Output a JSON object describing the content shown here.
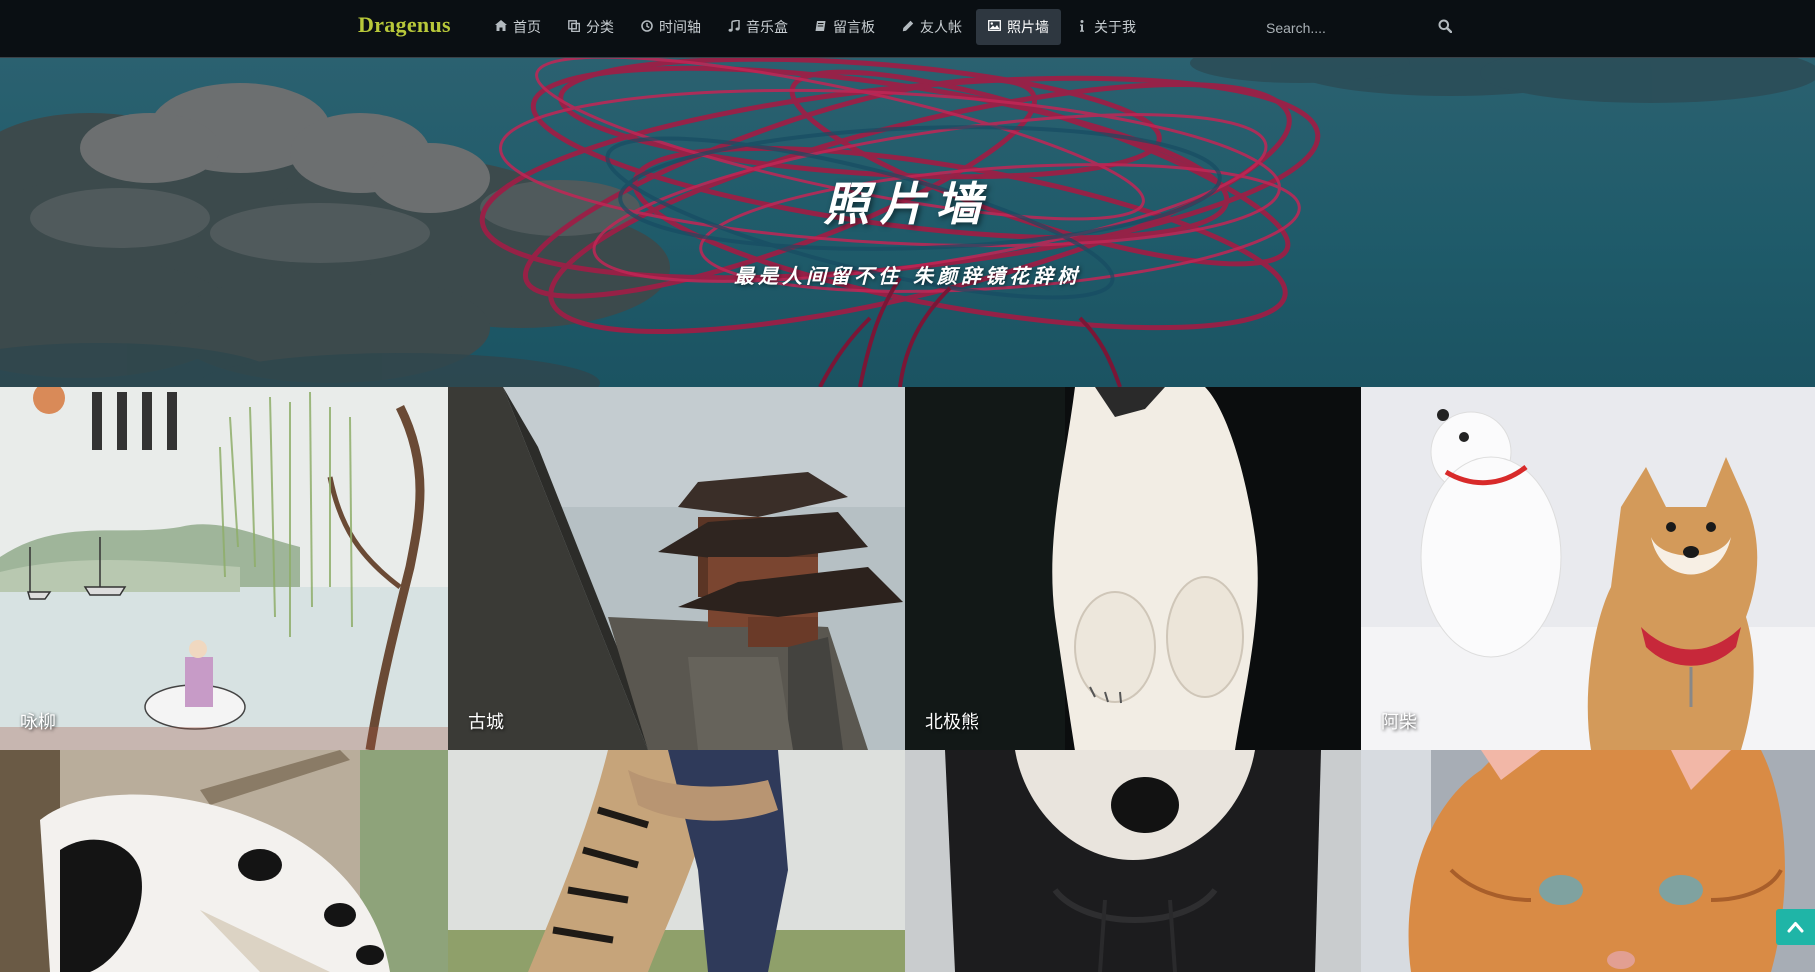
{
  "brand": "Dragenus",
  "nav": [
    {
      "label": "首页",
      "icon": "home-icon"
    },
    {
      "label": "分类",
      "icon": "copy-icon"
    },
    {
      "label": "时间轴",
      "icon": "clock-icon"
    },
    {
      "label": "音乐盒",
      "icon": "music-icon"
    },
    {
      "label": "留言板",
      "icon": "book-icon"
    },
    {
      "label": "友人帐",
      "icon": "pencil-icon"
    },
    {
      "label": "照片墙",
      "icon": "image-icon",
      "active": true
    },
    {
      "label": "关于我",
      "icon": "info-icon"
    }
  ],
  "search": {
    "placeholder": "Search...."
  },
  "hero": {
    "title": "照片墙",
    "subtitle": "最是人间留不住 朱颜辞镜花辞树"
  },
  "gallery": [
    {
      "caption": "咏柳"
    },
    {
      "caption": "古城"
    },
    {
      "caption": "北极熊"
    },
    {
      "caption": "阿柴"
    },
    {
      "caption": ""
    },
    {
      "caption": ""
    },
    {
      "caption": ""
    },
    {
      "caption": ""
    }
  ],
  "colors": {
    "brand": "#b8c83a",
    "navbar_bg": "#0a1014",
    "nav_active_bg": "#2e3740",
    "hero_bg": "#1f5b6a",
    "back_to_top": "#1fb5a7"
  }
}
